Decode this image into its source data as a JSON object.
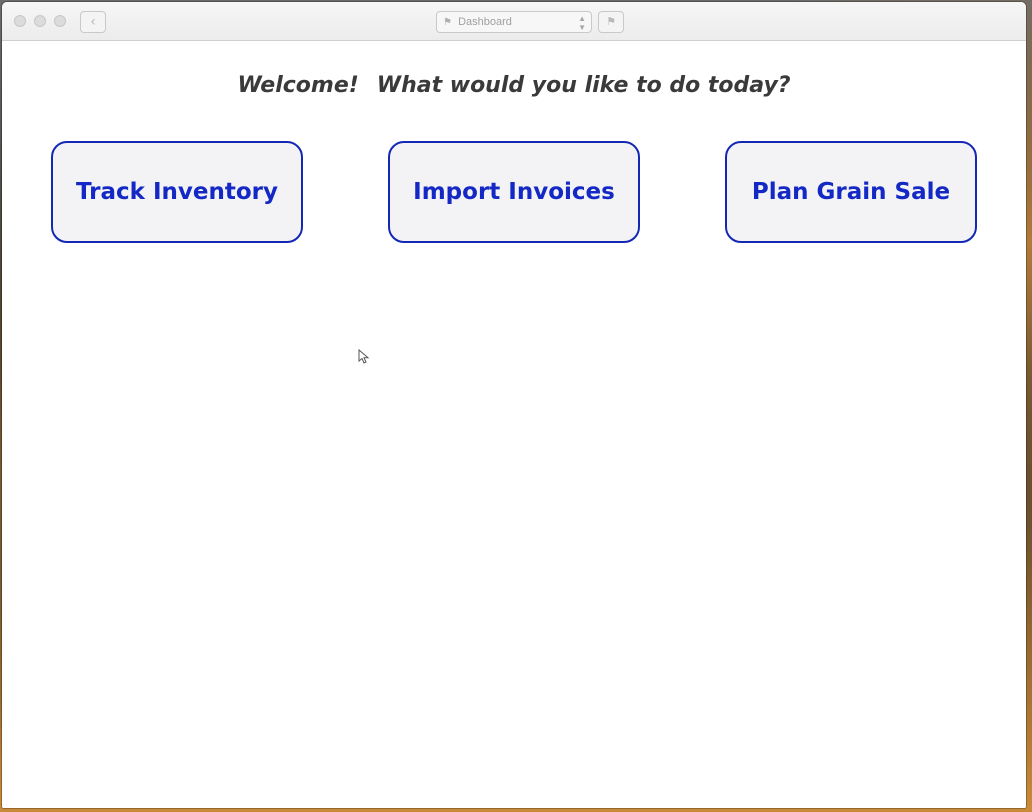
{
  "window": {
    "nav_select_value": "Dashboard",
    "nav_select_icon": "flag-icon",
    "back_icon": "chevron-left-icon",
    "flag_button_icon": "flag-icon"
  },
  "main": {
    "welcome_lead": "Welcome!",
    "welcome_question": "What would you like to do today?",
    "actions": [
      {
        "label": "Track Inventory"
      },
      {
        "label": "Import Invoices"
      },
      {
        "label": "Plan Grain Sale"
      }
    ]
  },
  "colors": {
    "accent": "#1328c4",
    "button_bg": "#f3f3f6",
    "welcome_text": "#3a3a3a"
  }
}
